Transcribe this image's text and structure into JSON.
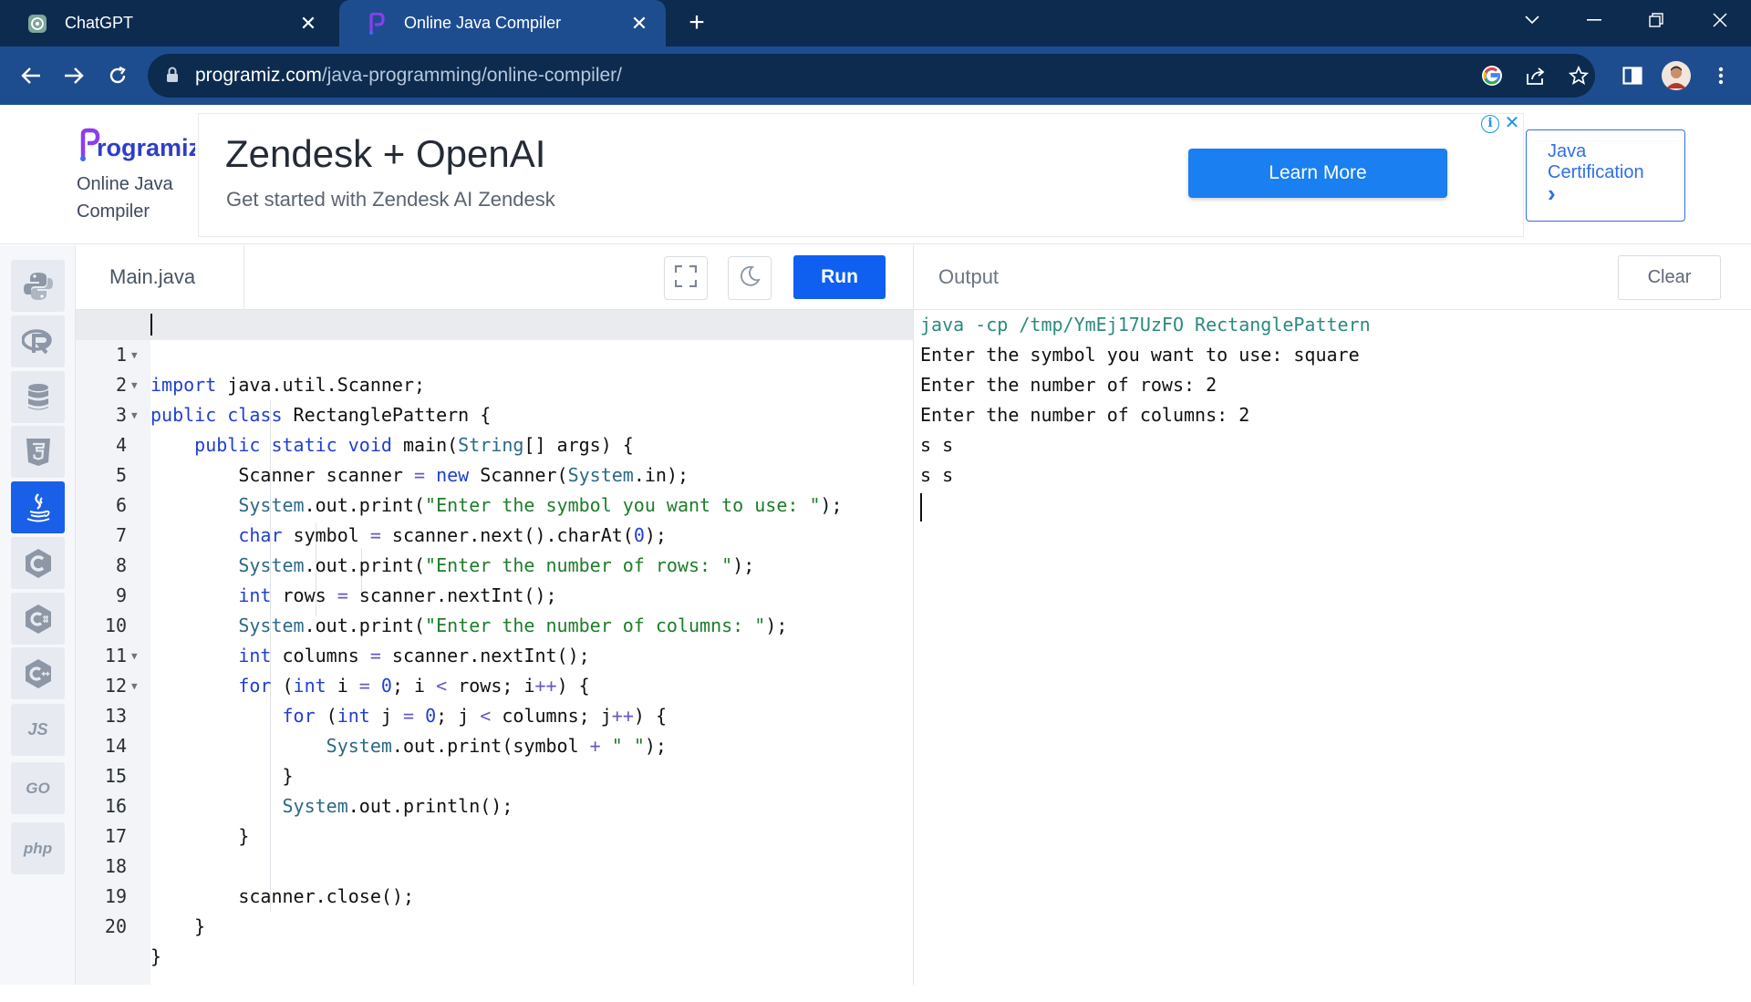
{
  "browser": {
    "tabs": [
      {
        "title": "ChatGPT",
        "icon": "chatgpt-icon"
      },
      {
        "title": "Online Java Compiler",
        "icon": "programiz-icon"
      }
    ],
    "url_domain": "programiz.com",
    "url_path": "/java-programming/online-compiler/"
  },
  "site": {
    "logo_text": "Programiz",
    "subtitle_line1": "Online Java",
    "subtitle_line2": "Compiler"
  },
  "ad": {
    "title": "Zendesk + OpenAI",
    "subtitle": "Get started with Zendesk AI Zendesk",
    "button": "Learn More"
  },
  "certification": {
    "line1": "Java",
    "line2": "Certification",
    "arrow": "›"
  },
  "sidebar_languages": [
    "python",
    "r",
    "sql",
    "html",
    "java",
    "c",
    "csharp",
    "cpp",
    "js",
    "go",
    "php"
  ],
  "sidebar_labels": {
    "js": "JS",
    "go": "GO",
    "php": "php"
  },
  "editor": {
    "filename": "Main.java",
    "run_label": "Run"
  },
  "code_lines": [
    "import java.util.Scanner;",
    "public class RectanglePattern {",
    "    public static void main(String[] args) {",
    "        Scanner scanner = new Scanner(System.in);",
    "        System.out.print(\"Enter the symbol you want to use: \");",
    "        char symbol = scanner.next().charAt(0);",
    "        System.out.print(\"Enter the number of rows: \");",
    "        int rows = scanner.nextInt();",
    "        System.out.print(\"Enter the number of columns: \");",
    "        int columns = scanner.nextInt();",
    "        for (int i = 0; i < rows; i++) {",
    "            for (int j = 0; j < columns; j++) {",
    "                System.out.print(symbol + \" \");",
    "            }",
    "            System.out.println();",
    "        }",
    "",
    "        scanner.close();",
    "    }",
    "}"
  ],
  "line_numbers": [
    "1",
    "2",
    "3",
    "4",
    "5",
    "6",
    "7",
    "8",
    "9",
    "10",
    "11",
    "12",
    "13",
    "14",
    "15",
    "16",
    "17",
    "18",
    "19",
    "20"
  ],
  "output": {
    "label": "Output",
    "clear_label": "Clear",
    "lines": [
      "java -cp /tmp/YmEj17UzFO RectanglePattern",
      "Enter the symbol you want to use: square",
      "Enter the number of rows: 2",
      "Enter the number of columns: 2",
      "s s",
      "s s"
    ]
  },
  "colors": {
    "chrome_dark": "#0c2b4f",
    "chrome_toolbar": "#1e4d8f",
    "accent_blue": "#0f5ff0",
    "keyword": "#1f3fd1",
    "string": "#1d7d2a"
  }
}
